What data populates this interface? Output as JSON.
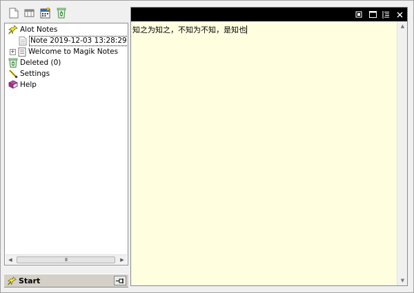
{
  "toolbar": {
    "icons": [
      "new-note-icon",
      "columns-icon",
      "calendar-icon",
      "recycle-icon"
    ]
  },
  "tree": {
    "root_label": "Alot Notes",
    "note_label": "Note 2019-12-03 13:28:29",
    "welcome_label": "Welcome to Magik Notes",
    "expander_glyph": "+",
    "deleted_label": "Deleted (0)",
    "settings_label": "Settings",
    "help_label": "Help"
  },
  "scrollbar": {
    "grip": "III"
  },
  "startbar": {
    "start_label": "Start"
  },
  "editor": {
    "text": "知之为知之，不知为不知，是知也",
    "background": "#ffffe0",
    "titlebar_color": "#000000"
  }
}
